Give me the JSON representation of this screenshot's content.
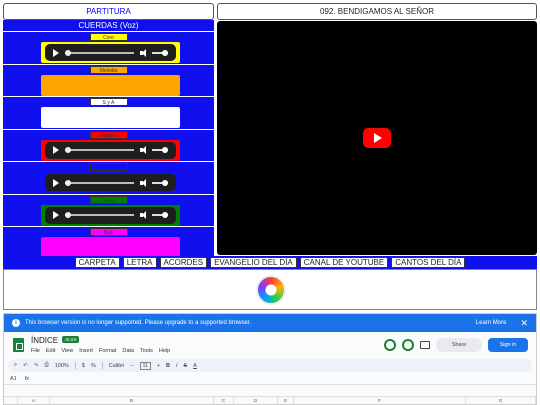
{
  "header": {
    "partitura_label": "PARTITURA",
    "song_title": "092. BENDIGAMOS AL SEÑOR"
  },
  "cuerdas": {
    "title": "CUERDAS (Voz)",
    "tracks": [
      {
        "label": "Coro",
        "label_bg": "#ffff00",
        "box_color": "#ffff00",
        "has_player": true
      },
      {
        "label": "Melodia",
        "label_bg": "#ffa500",
        "box_color": "#ffa500",
        "has_player": false
      },
      {
        "label": "S y A",
        "label_bg": "#ffffff",
        "box_color": "#ffffff",
        "has_player": false
      },
      {
        "label": "Soprano",
        "label_bg": "#ff0000",
        "box_color": "#ff0000",
        "has_player": true
      },
      {
        "label": "",
        "label_bg": "#1010ee",
        "box_color": "#1010ee",
        "has_player": true
      },
      {
        "label": "Tenor",
        "label_bg": "#008000",
        "box_color": "#008000",
        "has_player": true
      },
      {
        "label": "Bajo",
        "label_bg": "#ff00ff",
        "box_color": "#ff00ff",
        "has_player": false
      }
    ]
  },
  "nav": [
    "CARPETA",
    "LETRA",
    "ACORDES",
    "EVANGELIO DEL DÍA",
    "CANAL DE YOUTUBE",
    "CANTOS DEL DÍA"
  ],
  "video": {
    "icon": "youtube-play-icon"
  },
  "sheets": {
    "banner_text": "This browser version is no longer supported. Please upgrade to a supported browser.",
    "learn_more": "Learn More",
    "close": "✕",
    "doc_title": "ÍNDICE",
    "badge": ".XLSX",
    "menus": [
      "File",
      "Edit",
      "View",
      "Insert",
      "Format",
      "Data",
      "Tools",
      "Help"
    ],
    "share": "Share",
    "signin": "Sign in",
    "zoom": "100%",
    "font": "Calibri",
    "font_size": "11",
    "cell_ref": "A1",
    "columns": [
      "A",
      "B",
      "C",
      "D",
      "E",
      "F",
      "G"
    ]
  }
}
